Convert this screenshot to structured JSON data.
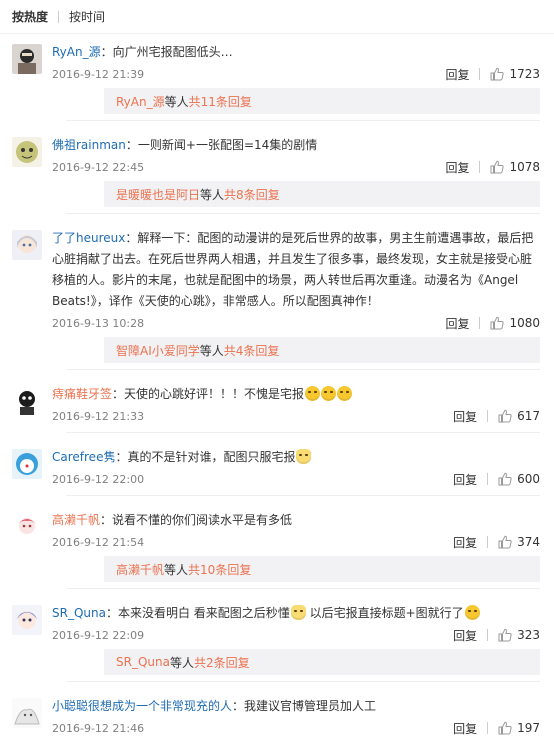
{
  "tabs": {
    "hot": "按热度",
    "time": "按时间"
  },
  "labels": {
    "reply": "回复",
    "etc": " 等人 ",
    "total_prefix": "共",
    "total_suffix": "条回复"
  },
  "comments": [
    {
      "user": "RyAn_源",
      "text": "：向广州宅报配图低头…",
      "date": "2016-9-12 21:39",
      "likes": "1723",
      "sub": {
        "who": "RyAn_源",
        "count": "11"
      }
    },
    {
      "user": "佛祖rainman",
      "text": "：一则新闻+一张配图=14集的剧情",
      "date": "2016-9-12 22:45",
      "likes": "1078",
      "sub": {
        "who": "是暖暖也是阿日",
        "count": "8"
      }
    },
    {
      "user": "了了heureux",
      "text": "：解释一下：配图的动漫讲的是死后世界的故事，男主生前遭遇事故，最后把心脏捐献了出去。在死后世界两人相遇，并且发生了很多事，最终发现，女主就是接受心脏移植的人。影片的末尾，也就是配图中的场景，两人转世后再次重逢。动漫名为《Angel Beats!》，译作《天使的心跳》，非常感人。所以配图真神作！",
      "date": "2016-9-13 10:28",
      "likes": "1080",
      "sub": {
        "who": "智障AI小爱同学",
        "count": "4"
      }
    },
    {
      "user": "痔痛鞋牙签",
      "text": "：天使的心跳好评！！！不愧是宅报",
      "date": "2016-9-12 21:33",
      "likes": "617"
    },
    {
      "user": "Carefree隽",
      "text": "：真的不是针对谁，配图只服宅报",
      "date": "2016-9-12 22:00",
      "likes": "600"
    },
    {
      "user": "高濑千帆",
      "text": "：说看不懂的你们阅读水平是有多低",
      "date": "2016-9-12 21:54",
      "likes": "374",
      "sub": {
        "who": "高濑千帆",
        "count": "10"
      }
    },
    {
      "user": "SR_Quna",
      "text": "：本来没看明白 看来配图之后秒懂",
      "text2": "以后宅报直接标题+图就行了",
      "date": "2016-9-12 22:09",
      "likes": "323",
      "sub": {
        "who": "SR_Quna",
        "count": "2"
      }
    },
    {
      "user": "小聪聪很想成为一个非常现充的人",
      "text": "：我建议官博管理员加人工",
      "date": "2016-9-12 21:46",
      "likes": "197"
    }
  ],
  "colors": {
    "username": "#eb7350",
    "username_blue": "#1e6cb4",
    "date": "#808080",
    "sub_bg": "#f2f2f5"
  },
  "icons": [
    "thumbs-up-icon",
    "emoji-icon"
  ]
}
